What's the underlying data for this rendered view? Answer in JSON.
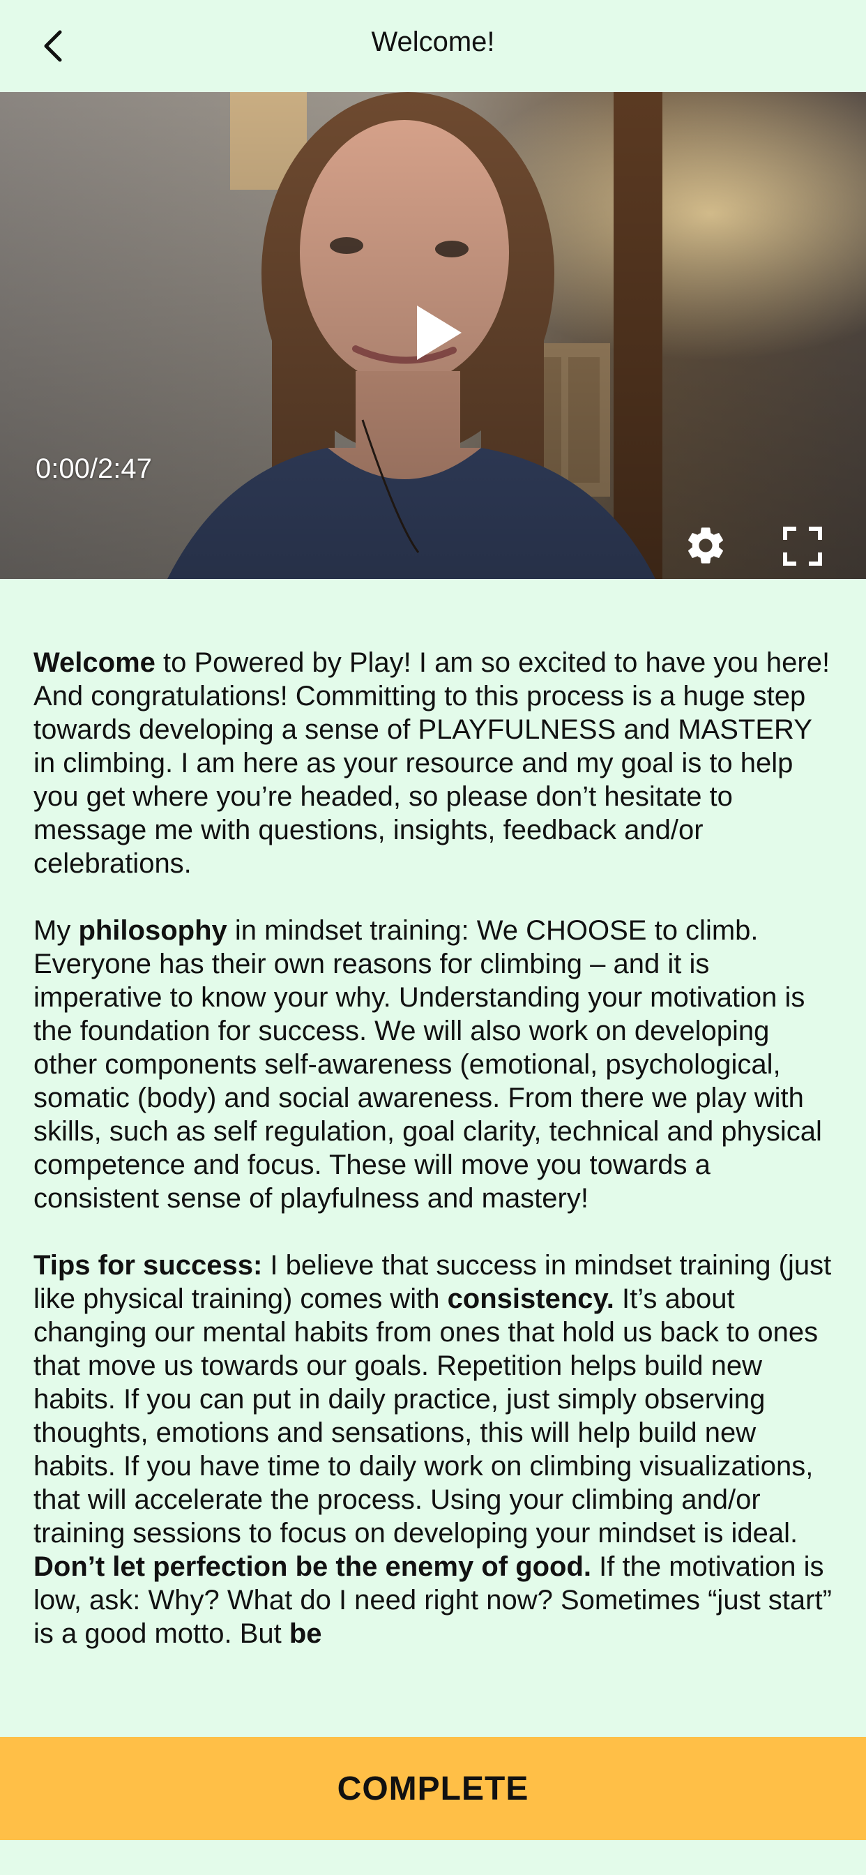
{
  "header": {
    "title": "Welcome!",
    "back_icon": "chevron-left-icon"
  },
  "video": {
    "time_display": "0:00/2:47",
    "progress_fraction": 0.0,
    "icons": {
      "play": "play-icon",
      "settings": "gear-icon",
      "fullscreen": "fullscreen-icon"
    }
  },
  "content": {
    "p1": {
      "bold": "Welcome",
      "text": " to Powered by Play! I am so excited to have you here! And congratulations! Committing to this process is a huge step towards developing a sense of PLAYFULNESS and MASTERY in climbing. I am here as your resource and my goal is to help you get where you’re headed, so please don’t hesitate to message me with questions, insights, feedback and/or celebrations."
    },
    "p2": {
      "pre": "My ",
      "bold": "philosophy",
      "text": " in mindset training: We CHOOSE to climb. Everyone has their own reasons for climbing – and it is imperative to know your why. Understanding your motivation is the foundation for success. We will also work on developing other components self-awareness (emotional, psychological, somatic (body) and social awareness. From there we play with skills, such as self regulation, goal clarity, technical and physical competence and focus. These will move you towards a consistent sense of playfulness and mastery!"
    },
    "p3": {
      "bold1": "Tips for success:",
      "text1": " I believe that success in mindset training (just like physical training) comes with ",
      "bold2": "consistency.",
      "text2": " It’s about changing our mental habits from ones that hold us back to ones that move us towards our goals. Repetition helps build new habits. If you can put in daily practice, just simply observing thoughts, emotions and sensations, this will help build new habits. If you have time to daily work on climbing visualizations, that will accelerate the process. Using your climbing and/or training sessions to focus on developing your mindset is ideal. ",
      "bold3": "Don’t let perfection be the enemy of good.",
      "text3": " If the motivation is low, ask: Why? What do I need right now? Sometimes “just start” is a good motto. But ",
      "bold4": "be"
    }
  },
  "footer": {
    "complete_label": "COMPLETE",
    "button_color": "#ffbf47"
  },
  "colors": {
    "background": "#e3fbea"
  }
}
